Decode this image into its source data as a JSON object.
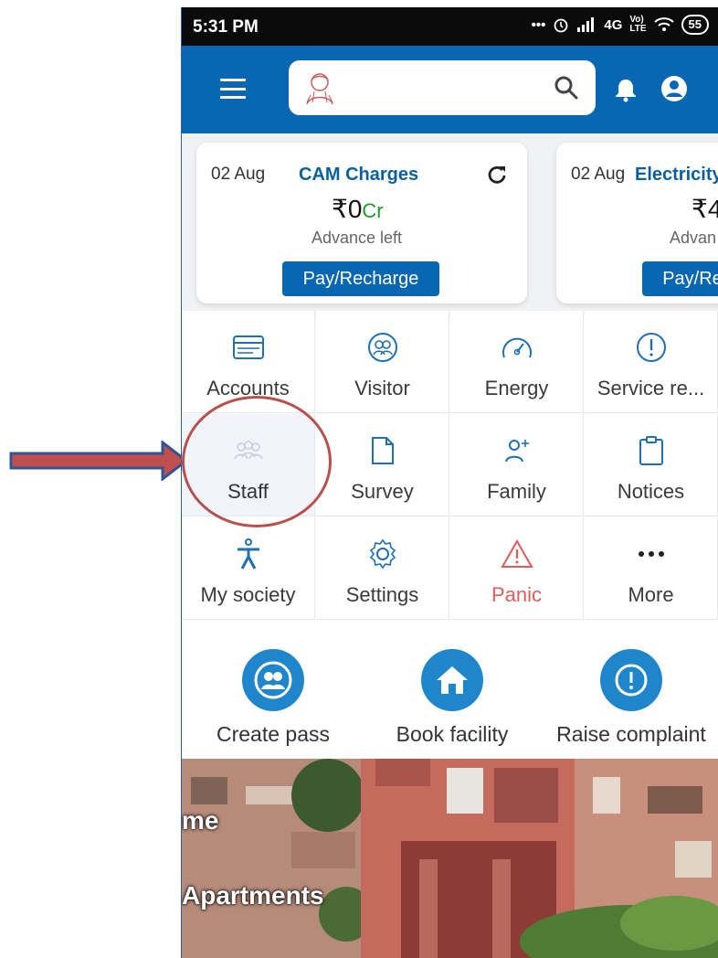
{
  "status_bar": {
    "time": "5:31 PM",
    "network": "4G",
    "battery": "55"
  },
  "app_bar": {
    "search_placeholder": ""
  },
  "cards": [
    {
      "date": "02 Aug",
      "title": "CAM Charges",
      "amount": "₹0",
      "amount_unit": "Cr",
      "subtitle": "Advance left",
      "button": "Pay/Recharge"
    },
    {
      "date": "02 Aug",
      "title": "Electricity",
      "amount": "₹4",
      "subtitle": "Advan",
      "button": "Pay/Re"
    }
  ],
  "grid": [
    {
      "label": "Accounts",
      "icon": "card-icon"
    },
    {
      "label": "Visitor",
      "icon": "visitor-icon"
    },
    {
      "label": "Energy",
      "icon": "gauge-icon"
    },
    {
      "label": "Service re...",
      "icon": "exclamation-circle-icon"
    },
    {
      "label": "Staff",
      "icon": "staff-icon"
    },
    {
      "label": "Survey",
      "icon": "document-icon"
    },
    {
      "label": "Family",
      "icon": "family-icon"
    },
    {
      "label": "Notices",
      "icon": "clipboard-icon"
    },
    {
      "label": "My society",
      "icon": "person-icon"
    },
    {
      "label": "Settings",
      "icon": "gear-icon"
    },
    {
      "label": "Panic",
      "icon": "warning-icon"
    },
    {
      "label": "More",
      "icon": "more-icon"
    }
  ],
  "quick_actions": [
    {
      "label": "Create pass",
      "icon": "visitor-pass-icon"
    },
    {
      "label": "Book facility",
      "icon": "home-icon"
    },
    {
      "label": "Raise complaint",
      "icon": "exclamation-icon"
    }
  ],
  "banner": {
    "line1": "me",
    "line2": "Apartments"
  },
  "colors": {
    "primary": "#0866b3",
    "panic": "#e15b5b",
    "annotation": "#b8514c",
    "arrow_fill": "#c0504d",
    "arrow_stroke": "#2f5597"
  }
}
